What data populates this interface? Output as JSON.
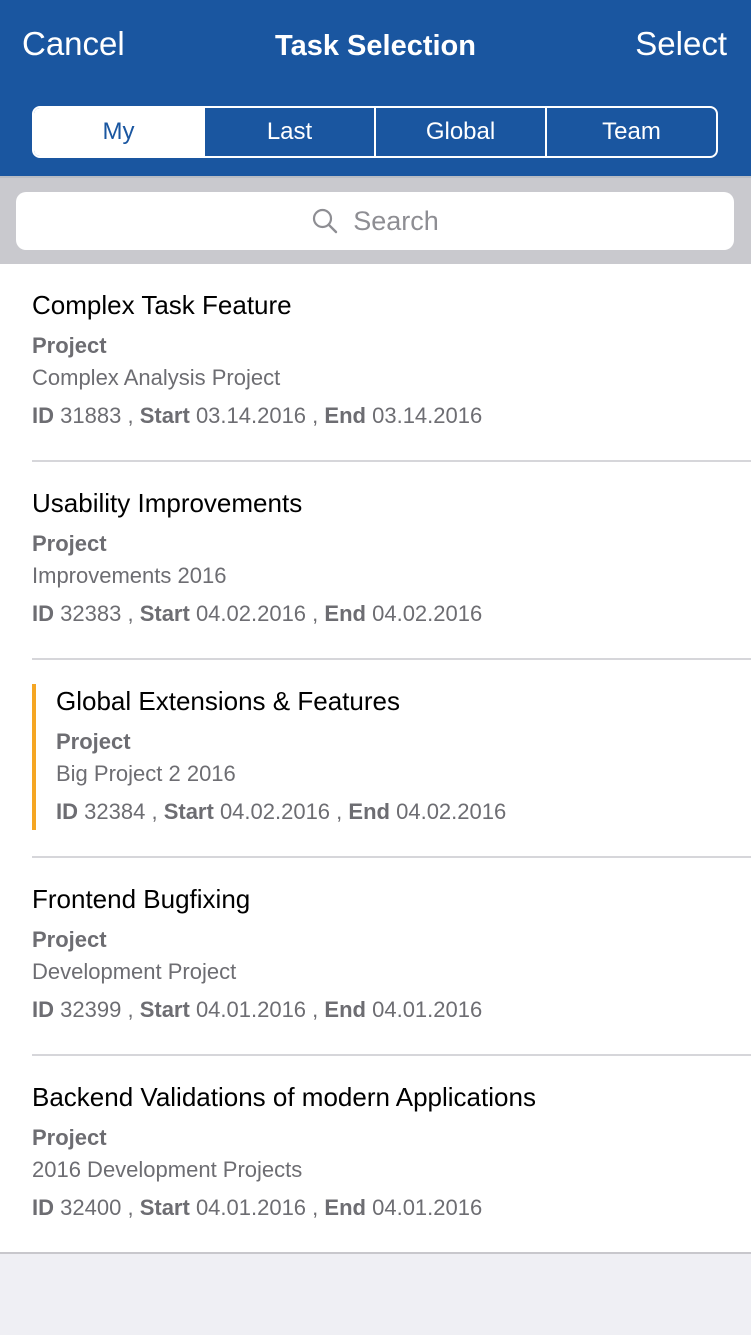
{
  "nav": {
    "cancel_label": "Cancel",
    "title": "Task Selection",
    "select_label": "Select"
  },
  "tabs": [
    {
      "label": "My",
      "active": true
    },
    {
      "label": "Last",
      "active": false
    },
    {
      "label": "Global",
      "active": false
    },
    {
      "label": "Team",
      "active": false
    }
  ],
  "search": {
    "icon": "search-icon",
    "placeholder": "Search"
  },
  "colors": {
    "brand": "#1a56a0",
    "highlight_accent": "#f5a623"
  },
  "labels": {
    "project": "Project",
    "id": "ID",
    "start": "Start",
    "end": "End",
    "sep": ","
  },
  "tasks": [
    {
      "title": "Complex Task Feature",
      "project": "Complex Analysis Project",
      "id": "31883",
      "start": "03.14.2016",
      "end": "03.14.2016",
      "highlighted": false
    },
    {
      "title": "Usability Improvements",
      "project": "Improvements 2016",
      "id": "32383",
      "start": "04.02.2016",
      "end": "04.02.2016",
      "highlighted": false
    },
    {
      "title": "Global Extensions & Features",
      "project": "Big Project 2 2016",
      "id": "32384",
      "start": "04.02.2016",
      "end": "04.02.2016",
      "highlighted": true
    },
    {
      "title": "Frontend Bugfixing",
      "project": "Development Project",
      "id": "32399",
      "start": "04.01.2016",
      "end": "04.01.2016",
      "highlighted": false
    },
    {
      "title": "Backend Validations of modern Applications",
      "project": "2016 Development Projects",
      "id": "32400",
      "start": "04.01.2016",
      "end": "04.01.2016",
      "highlighted": false
    }
  ]
}
